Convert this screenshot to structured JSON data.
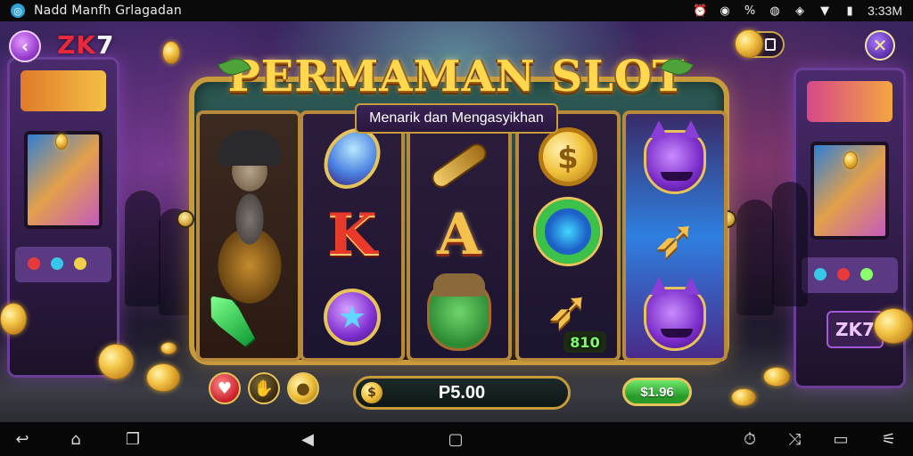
{
  "status_bar": {
    "app_title": "Nadd Manfh Grlagadan",
    "time": "3:33M",
    "icons": [
      "app-icon",
      "alarm-icon",
      "settings-icon",
      "battery-saver-icon",
      "notification-icon",
      "network-icon",
      "wifi-icon",
      "battery-icon"
    ]
  },
  "header": {
    "back_icon": "back-arrow-icon",
    "brand_prefix": "ZK",
    "brand_number": "7",
    "coin_icon": "coin-icon",
    "pill_icon": "wallet-icon",
    "close_icon": "close-icon"
  },
  "game": {
    "title": "PERMAMAN SLOT",
    "subtitle": "Menarik dan Mengasyikhan",
    "cabinet_logo": "ZK7",
    "reels": [
      {
        "symbols": [
          "warrior",
          "warrior",
          "emerald-sword"
        ]
      },
      {
        "symbols": [
          "blue-gem",
          "K",
          "purple-star-gem"
        ]
      },
      {
        "symbols": [
          "golden-club",
          "A",
          "green-elf"
        ]
      },
      {
        "symbols": [
          "gold-coin",
          "Q-ring",
          "golden-arrow"
        ]
      },
      {
        "symbols": [
          "purple-mask",
          "golden-arrow",
          "purple-mask"
        ]
      }
    ],
    "letter_k": "K",
    "letter_a": "A",
    "win_value": "810",
    "colors": {
      "gold": "#f4c24c",
      "frame": "#c79a3a",
      "teal": "#2e5a55",
      "accent_purple": "#9a3fd0",
      "spin_green": "#2a9a2a"
    }
  },
  "controls": {
    "red_button_icon": "heart-icon",
    "auto_button_icon": "hand-icon",
    "coin_button_icon": "coin-icon",
    "bet_icon": "coin-icon",
    "bet_icon_glyph": "$",
    "bet_value": "P5.00",
    "spin_label": "$1.96"
  },
  "nav_bar": {
    "icons": [
      "back-icon",
      "home-icon",
      "recents-icon",
      "triangle-back-icon",
      "home-pill-icon",
      "screen-record-icon",
      "shuffle-icon",
      "window-icon",
      "settings-sliders-icon"
    ]
  }
}
